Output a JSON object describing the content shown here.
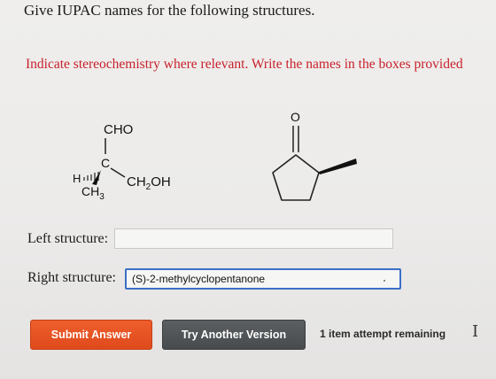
{
  "question": {
    "title": "Give IUPAC names for the following structures.",
    "instruction": "Indicate stereochemistry where relevant. Write the names in the boxes provided"
  },
  "left_structure": {
    "top_group": "CHO",
    "center_atom": "C",
    "hydrogen": "H",
    "bottom_group": "CH",
    "bottom_sub": "3",
    "right_group_pre": "CH",
    "right_group_sub": "2",
    "right_group_post": "OH"
  },
  "right_structure": {
    "carbonyl_atom": "O"
  },
  "answers": {
    "left_label": "Left structure:",
    "left_value": "",
    "right_label": "Right structure:",
    "right_value": "(S)-2-methylcyclopentanone"
  },
  "buttons": {
    "submit": "Submit Answer",
    "try_another": "Try Another Version"
  },
  "status": {
    "attempts": "1 item attempt remaining"
  },
  "colors": {
    "instruction": "#c8202a",
    "submit_button": "#e4531f",
    "try_button": "#505456",
    "input_focus_border": "#3b6fc7"
  }
}
